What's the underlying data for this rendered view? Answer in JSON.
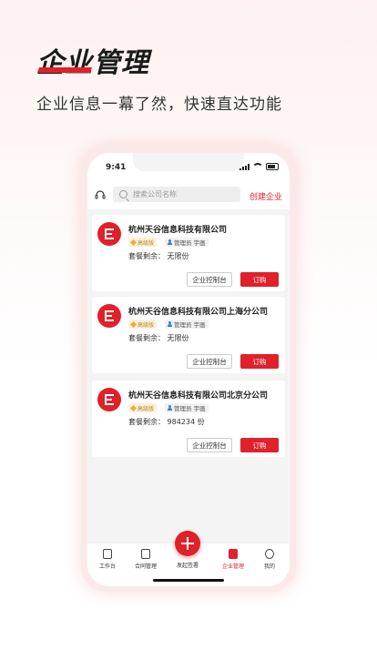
{
  "hero": {
    "title": "企业管理",
    "subtitle": "企业信息一幕了然，快速直达功能"
  },
  "status_bar": {
    "time": "9:41"
  },
  "top_bar": {
    "search_placeholder": "搜索公司名称",
    "create_label": "创建企业"
  },
  "companies": [
    {
      "name": "杭州天谷信息科技有限公司",
      "level": "高级版",
      "admin": "管理员 宇画",
      "quota": "套餐剩余：  无限份",
      "console_label": "企业控制台",
      "buy_label": "订购"
    },
    {
      "name": "杭州天谷信息科技有限公司上海分公司",
      "level": "高级版",
      "admin": "管理员 宇画",
      "quota": "套餐剩余：  无限份",
      "console_label": "企业控制台",
      "buy_label": "订购"
    },
    {
      "name": "杭州天谷信息科技有限公司北京分公司",
      "level": "高级版",
      "admin": "管理员 宇画",
      "quota": "套餐剩余：   984234 份",
      "console_label": "企业控制台",
      "buy_label": "订购"
    }
  ],
  "tab_bar": {
    "tabs": [
      {
        "label": "工作台",
        "icon": "desk-icon"
      },
      {
        "label": "合同管理",
        "icon": "contract-icon"
      },
      {
        "label": "企业管理",
        "icon": "enterprise-icon",
        "active": true
      },
      {
        "label": "我的",
        "icon": "smile-icon"
      }
    ],
    "fab_label": "发起签署"
  },
  "colors": {
    "accent": "#e0202a",
    "level_badge_bg": "#fbf0d8",
    "admin_icon": "#3a7bd5"
  }
}
